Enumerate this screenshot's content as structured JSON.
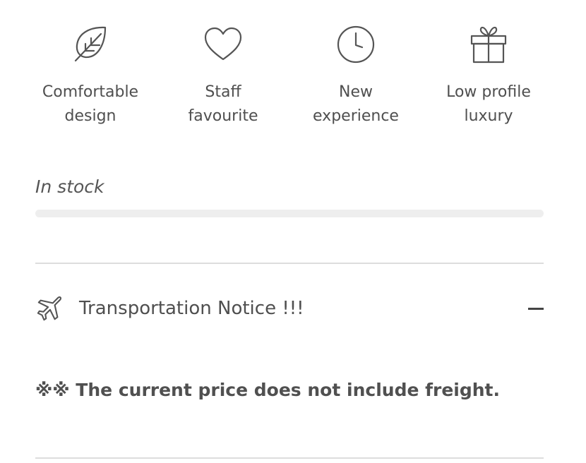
{
  "features": [
    {
      "icon": "leaf-icon",
      "line1": "Comfortable",
      "line2": "design"
    },
    {
      "icon": "heart-icon",
      "line1": "Staff",
      "line2": "favourite"
    },
    {
      "icon": "clock-icon",
      "line1": "New",
      "line2": "experience"
    },
    {
      "icon": "gift-icon",
      "line1": "Low profile",
      "line2": "luxury"
    }
  ],
  "stock": {
    "label": "In stock",
    "level": 0
  },
  "accordion": {
    "icon": "airplane-icon",
    "title": "Transportation Notice !!!",
    "expanded": true,
    "toggle_icon": "minus-icon",
    "content": "※※ The current price does not include freight."
  },
  "colors": {
    "text": "#4f4f4f",
    "icon": "#555555",
    "bar_track": "#eeeeee",
    "divider": "#dddddd"
  }
}
